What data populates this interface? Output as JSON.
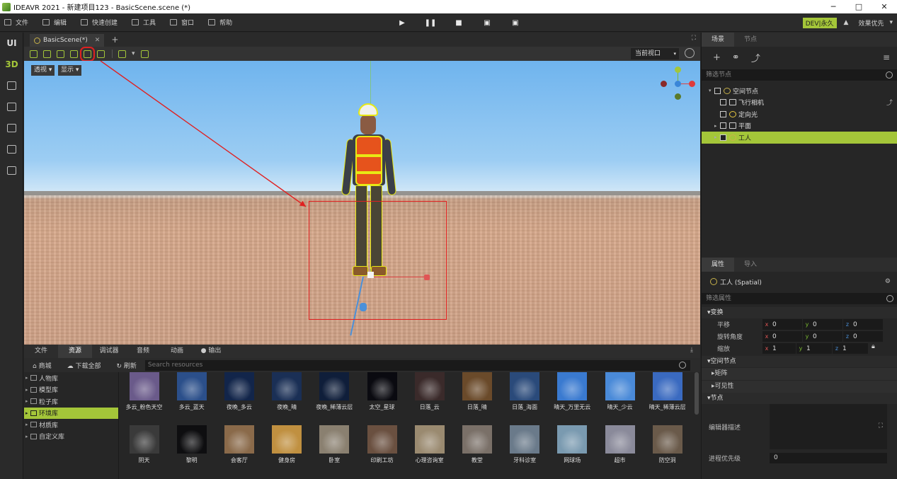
{
  "window": {
    "title": "IDEAVR 2021 - 新建项目123 - BasicScene.scene (*)",
    "min": "─",
    "max": "□",
    "close": "✕"
  },
  "menu": {
    "items": [
      {
        "label": "文件",
        "icon": "file-icon"
      },
      {
        "label": "编辑",
        "icon": "edit-icon"
      },
      {
        "label": "快速创建",
        "icon": "quick-create-icon"
      },
      {
        "label": "工具",
        "icon": "tools-icon"
      },
      {
        "label": "窗口",
        "icon": "window-icon"
      },
      {
        "label": "帮助",
        "icon": "help-icon"
      }
    ],
    "play": "▶",
    "pause": "❚❚",
    "stop": "■",
    "dev_badge": "DEV|永久",
    "quality": "效果优先",
    "quality_arrow": "▾"
  },
  "leftbar": {
    "ui": "UI",
    "d3": "3D"
  },
  "scene_tab": {
    "label": "BasicScene(*)",
    "close": "✕",
    "add": "+"
  },
  "viewport": {
    "current_view": "当前视口",
    "perspective": "透视 ▾",
    "display": "显示 ▾",
    "drop_arrow": "▾"
  },
  "scene_panel": {
    "tabs": [
      "场景",
      "节点"
    ],
    "filter_placeholder": "筛选节点",
    "nodes": [
      {
        "label": "空间节点",
        "depth": 0,
        "expand": "▾",
        "selected": false
      },
      {
        "label": "飞行相机",
        "depth": 1,
        "expand": "",
        "selected": false
      },
      {
        "label": "定向光",
        "depth": 1,
        "expand": "",
        "selected": false
      },
      {
        "label": "平面",
        "depth": 1,
        "expand": "▸",
        "selected": false
      },
      {
        "label": "工人",
        "depth": 1,
        "expand": "▸",
        "selected": true
      }
    ]
  },
  "props_panel": {
    "tabs": [
      "属性",
      "导入"
    ],
    "node_title": "工人 (Spatial)",
    "filter_placeholder": "筛选属性",
    "transform_group": "▾变换",
    "rows": [
      {
        "label": "平移",
        "x": "0",
        "y": "0",
        "z": "0"
      },
      {
        "label": "旋转角度",
        "x": "0",
        "y": "0",
        "z": "0"
      },
      {
        "label": "缩放",
        "x": "1",
        "y": "1",
        "z": "1"
      }
    ],
    "spatial_group": "▾空间节点",
    "matrix": "▸矩阵",
    "visibility": "▸可见性",
    "node_group": "▾节点",
    "editor_desc": "编辑器描述",
    "priority_label": "进程优先级",
    "priority_value": "0"
  },
  "bottom_panel": {
    "tabs": [
      "文件",
      "资源",
      "调试器",
      "音频",
      "动画",
      "● 输出"
    ],
    "active_tab": 1,
    "store": "商城",
    "download_all": "下载全部",
    "refresh": "刷新",
    "search_placeholder": "Search resources",
    "library": [
      {
        "label": "人物库",
        "selected": false
      },
      {
        "label": "模型库",
        "selected": false
      },
      {
        "label": "粒子库",
        "selected": false
      },
      {
        "label": "环境库",
        "selected": true
      },
      {
        "label": "材质库",
        "selected": false
      },
      {
        "label": "自定义库",
        "selected": false
      }
    ],
    "row1": [
      {
        "label": "多云_粉色天空",
        "color": "#6a5a8a"
      },
      {
        "label": "多云_蓝天",
        "color": "#2b4f8a"
      },
      {
        "label": "夜晚_多云",
        "color": "#12254a"
      },
      {
        "label": "夜晚_晴",
        "color": "#1a2f55"
      },
      {
        "label": "夜晚_稀薄云层",
        "color": "#0f1e3a"
      },
      {
        "label": "太空_星球",
        "color": "#0a0a10"
      },
      {
        "label": "日落_云",
        "color": "#3a2a2a"
      },
      {
        "label": "日落_晴",
        "color": "#6a4a2a"
      },
      {
        "label": "日落_海面",
        "color": "#2a4a7a"
      },
      {
        "label": "晴天_万里无云",
        "color": "#3a7ad0"
      },
      {
        "label": "晴天_少云",
        "color": "#4a8ad8"
      },
      {
        "label": "晴天_稀薄云层",
        "color": "#3a6ac0"
      }
    ],
    "row2": [
      {
        "label": "阴天",
        "color": "#3a3a3a"
      },
      {
        "label": "黎明",
        "color": "#0e0e10"
      },
      {
        "label": "会客厅",
        "color": "#8a6a4a"
      },
      {
        "label": "健身房",
        "color": "#c09040"
      },
      {
        "label": "卧室",
        "color": "#8a8070"
      },
      {
        "label": "印刷工坊",
        "color": "#6a5040"
      },
      {
        "label": "心理咨询室",
        "color": "#9a8a70"
      },
      {
        "label": "教堂",
        "color": "#7a7068"
      },
      {
        "label": "牙科诊室",
        "color": "#6a7a8a"
      },
      {
        "label": "网球场",
        "color": "#7a9ab0"
      },
      {
        "label": "超市",
        "color": "#8a8a9a"
      },
      {
        "label": "防空洞",
        "color": "#6a5a4a"
      }
    ]
  }
}
